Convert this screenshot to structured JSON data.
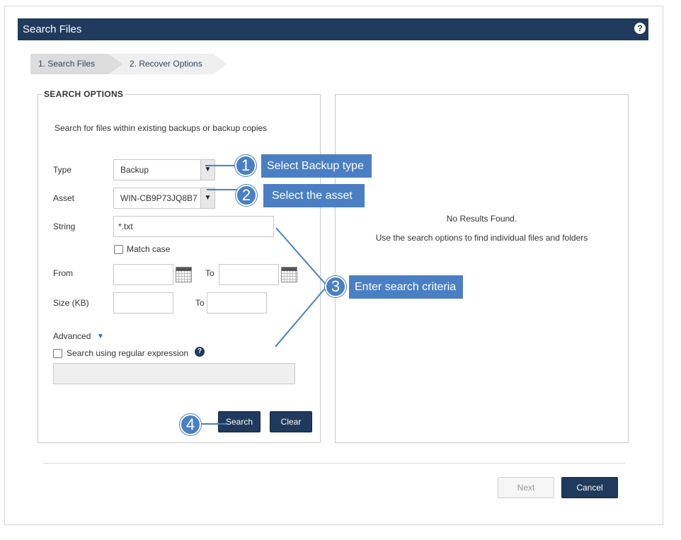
{
  "window": {
    "title": "Search Files",
    "help": "?"
  },
  "steps": [
    "1. Search Files",
    "2. Recover Options"
  ],
  "options": {
    "legend": "SEARCH OPTIONS",
    "description": "Search for files within existing backups or backup copies",
    "type_label": "Type",
    "type_value": "Backup",
    "asset_label": "Asset",
    "asset_value": "WIN-CB9P73JQ8B7",
    "string_label": "String",
    "string_value": "*.txt",
    "match_case_label": "Match case",
    "from_label": "From",
    "from_to_label": "To",
    "size_label": "Size (KB)",
    "size_to_label": "To",
    "advanced_label": "Advanced",
    "regex_label": "Search using regular expression",
    "regex_help": "?",
    "search_button": "Search",
    "clear_button": "Clear"
  },
  "results": {
    "title": "No Results Found.",
    "subtitle": "Use the search options to find individual files and folders"
  },
  "footer": {
    "next_button": "Next",
    "cancel_button": "Cancel"
  },
  "annotations": [
    {
      "number": "1",
      "text": "Select Backup type"
    },
    {
      "number": "2",
      "text": "Select the asset"
    },
    {
      "number": "3",
      "text": "Enter search criteria"
    },
    {
      "number": "4"
    }
  ],
  "colors": {
    "header": "#1f3a5c",
    "callout": "#4a7fc4",
    "button_dark": "#1f3a5c"
  }
}
